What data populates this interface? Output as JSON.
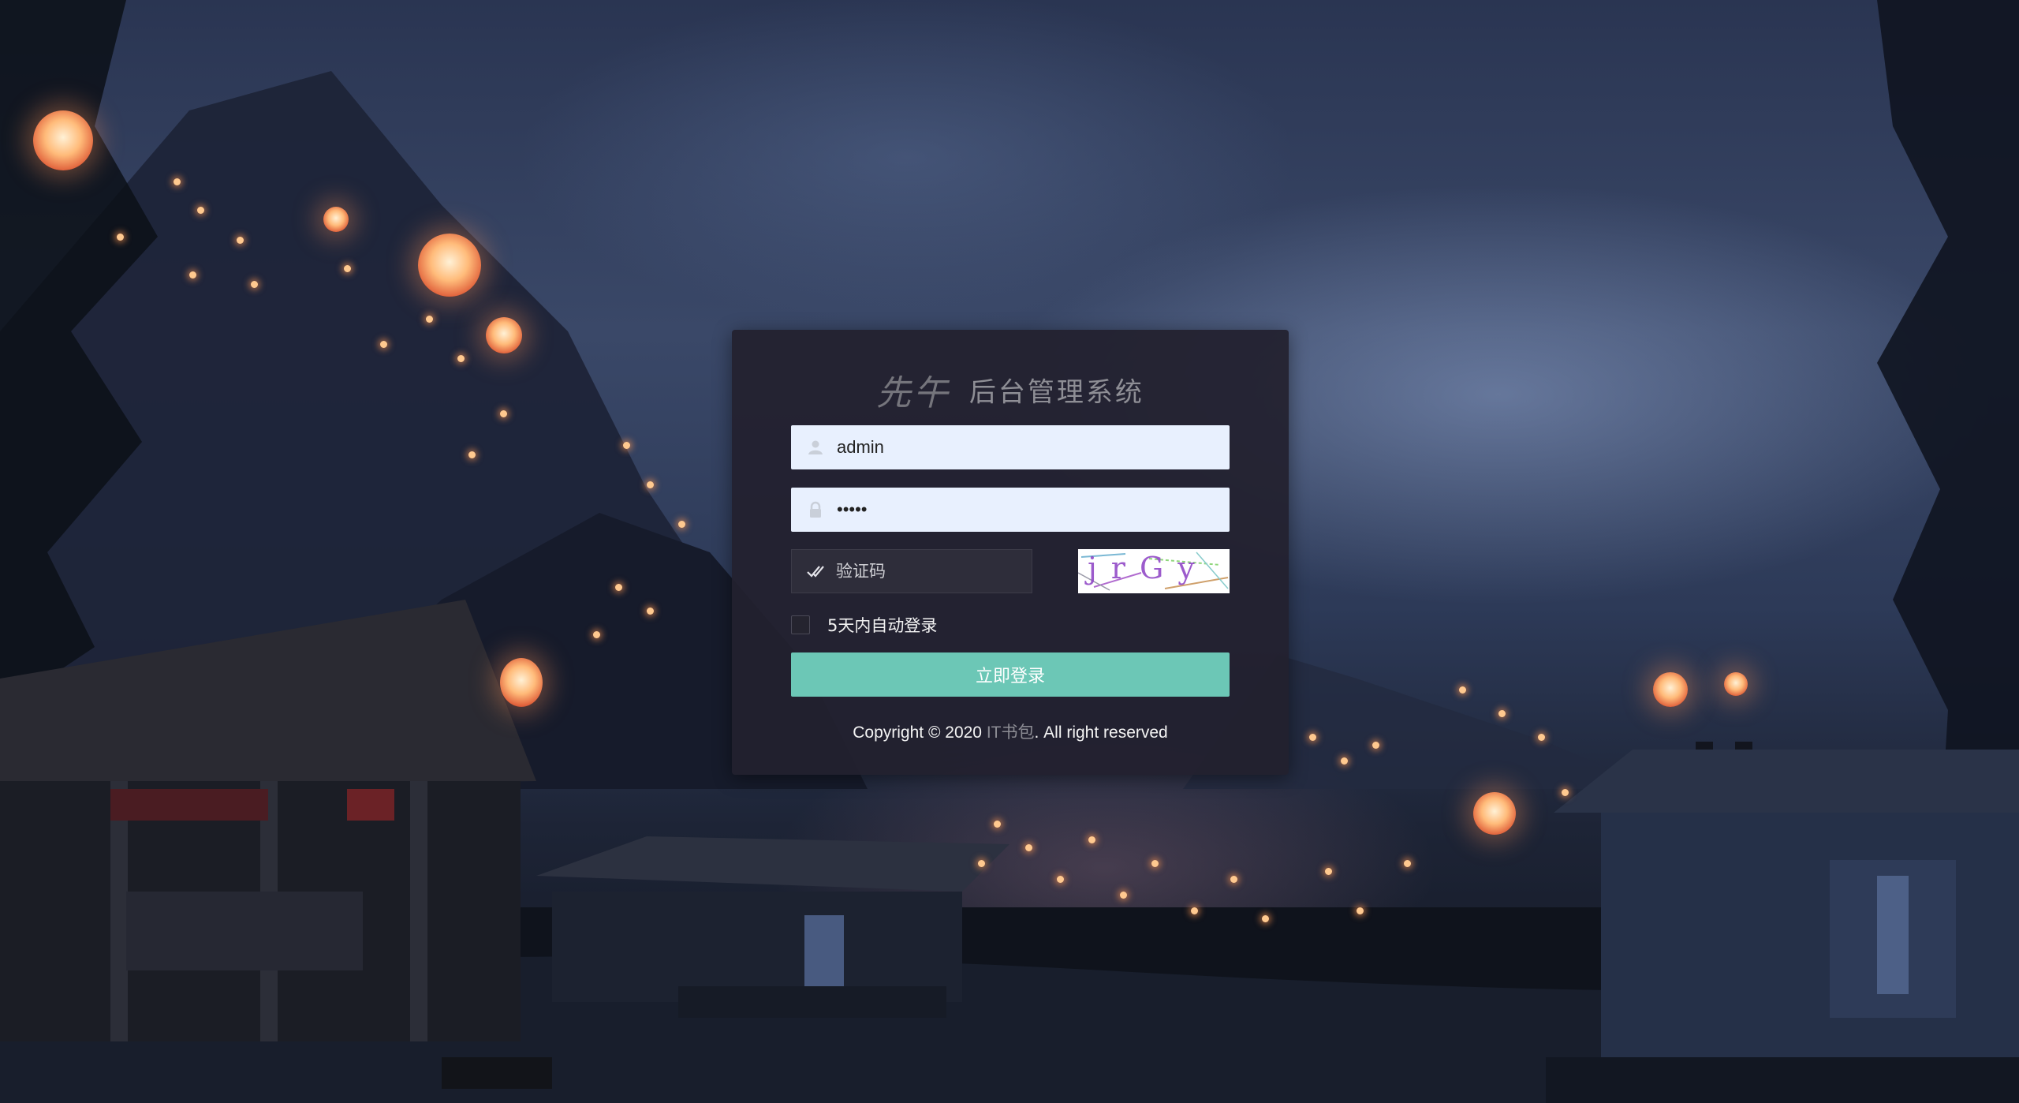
{
  "brand": {
    "logo_text": "先午",
    "title": "后台管理系统"
  },
  "form": {
    "username": {
      "value": "admin",
      "icon": "user-icon"
    },
    "password": {
      "value": "•••••",
      "icon": "lock-icon"
    },
    "captcha": {
      "placeholder": "验证码",
      "icon": "check-icon",
      "image_text": "jrGy"
    },
    "remember_label": "5天内自动登录",
    "remember_checked": false,
    "submit_label": "立即登录"
  },
  "footer": {
    "prefix": "Copyright © 2020 ",
    "link_text": "IT书包",
    "suffix": ". All right reserved"
  },
  "colors": {
    "panel": "#22202e",
    "button": "#6cc7b6",
    "input_bg": "#e8f0fe"
  }
}
